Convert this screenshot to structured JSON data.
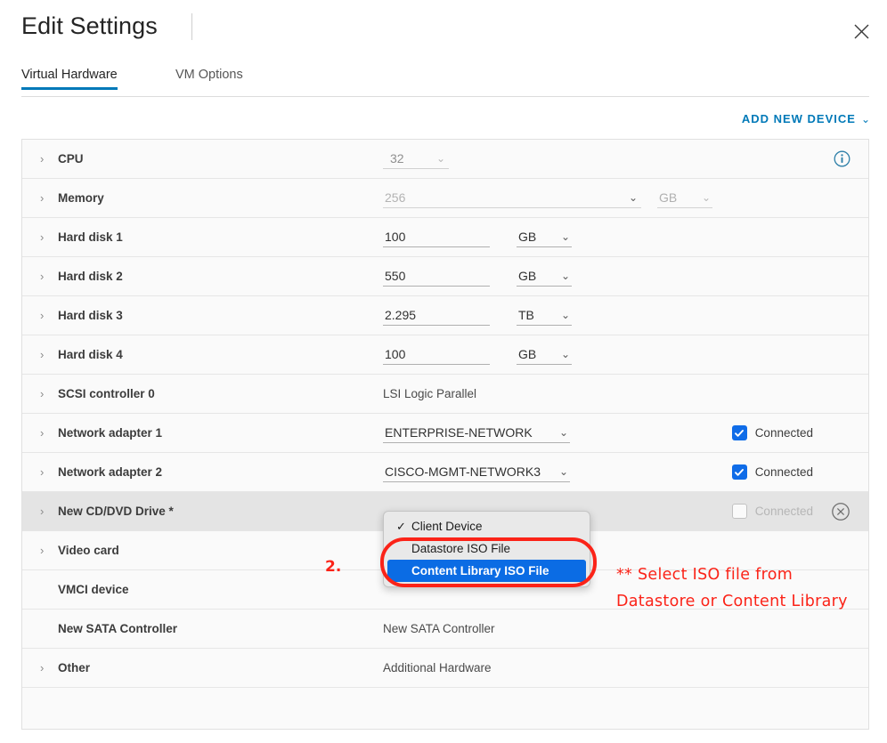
{
  "dialog": {
    "title": "Edit Settings",
    "close_icon": "close-icon"
  },
  "tabs": [
    {
      "label": "Virtual Hardware",
      "active": true
    },
    {
      "label": "VM Options",
      "active": false
    }
  ],
  "toolbar": {
    "add_new_device_label": "ADD NEW DEVICE",
    "add_new_device_caret": "⌄"
  },
  "devices": [
    {
      "label": "CPU",
      "value": "32",
      "unit": "",
      "kind": "cpu",
      "expandable": true,
      "info_icon": true
    },
    {
      "label": "Memory",
      "value": "256",
      "unit": "GB",
      "kind": "memory",
      "expandable": true,
      "disabled": true
    },
    {
      "label": "Hard disk 1",
      "value": "100",
      "unit": "GB",
      "kind": "disk",
      "expandable": true
    },
    {
      "label": "Hard disk 2",
      "value": "550",
      "unit": "GB",
      "kind": "disk",
      "expandable": true
    },
    {
      "label": "Hard disk 3",
      "value": "2.295",
      "unit": "TB",
      "kind": "disk",
      "expandable": true
    },
    {
      "label": "Hard disk 4",
      "value": "100",
      "unit": "GB",
      "kind": "disk",
      "expandable": true
    },
    {
      "label": "SCSI controller 0",
      "value": "LSI Logic Parallel",
      "kind": "static",
      "expandable": true
    },
    {
      "label": "Network adapter 1",
      "value": "ENTERPRISE-NETWORK",
      "kind": "network",
      "expandable": true,
      "connected_label": "Connected",
      "connected": true
    },
    {
      "label": "Network adapter 2",
      "value": "CISCO-MGMT-NETWORK3",
      "kind": "network",
      "expandable": true,
      "connected_label": "Connected",
      "connected": true
    },
    {
      "label": "New CD/DVD Drive *",
      "value": "",
      "kind": "cddvd",
      "expandable": true,
      "selected": true,
      "connected_label": "Connected",
      "connected": false,
      "connected_disabled": true,
      "remove_icon": "remove-circle-icon"
    },
    {
      "label": "Video card",
      "value": "",
      "kind": "blank",
      "expandable": true
    },
    {
      "label": "VMCI device",
      "value": "",
      "kind": "blank",
      "expandable": false
    },
    {
      "label": "New SATA Controller",
      "value": "New SATA Controller",
      "kind": "static",
      "expandable": false
    },
    {
      "label": "Other",
      "value": "Additional Hardware",
      "kind": "static",
      "expandable": true
    },
    {
      "label": "",
      "value": "",
      "kind": "empty",
      "expandable": false
    }
  ],
  "dropdown": {
    "items": [
      {
        "label": "Client Device",
        "checked": true,
        "highlighted": false
      },
      {
        "label": "Datastore ISO File",
        "checked": false,
        "highlighted": false
      },
      {
        "label": "Content Library ISO File",
        "checked": false,
        "highlighted": true
      }
    ],
    "check_glyph": "✓"
  },
  "annotations": {
    "step_marker": "2.",
    "note": "** Select ISO file from Datastore or Content Library",
    "color": "#fb2318"
  },
  "colors": {
    "accent": "#0079b8",
    "checkbox": "#0f6ce8",
    "highlight": "#0b6ce4",
    "annotation": "#fb2318",
    "row_bg": "#fafafa",
    "row_selected_bg": "#e4e4e4"
  }
}
